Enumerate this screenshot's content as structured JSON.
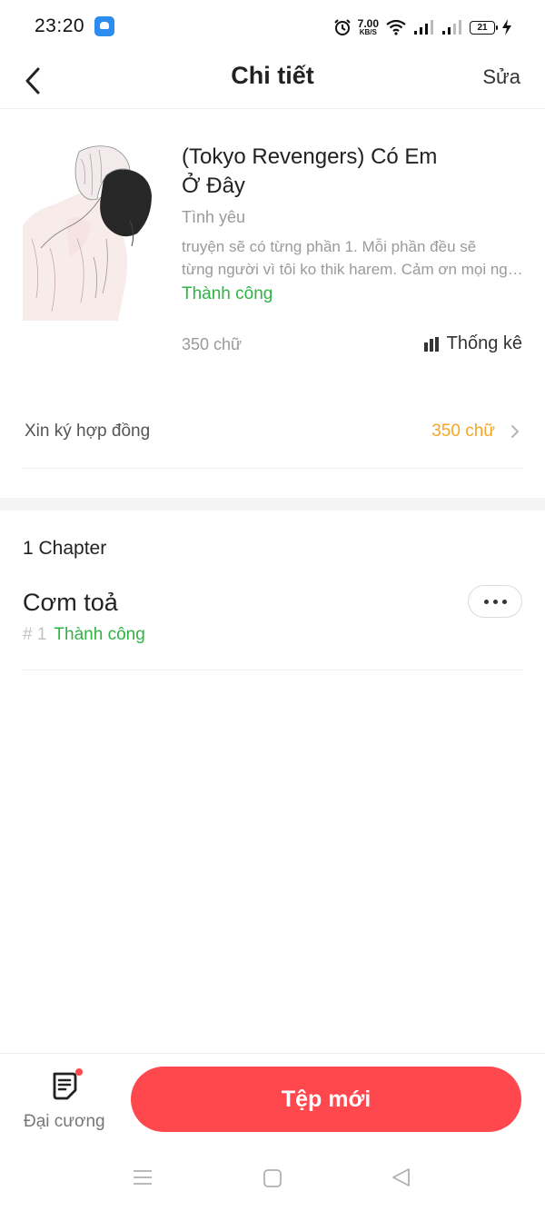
{
  "status_bar": {
    "time": "23:20",
    "speed_value": "7.00",
    "speed_unit": "KB/S",
    "battery": "21",
    "icons": [
      "app-store-icon",
      "alarm-icon",
      "wifi-icon",
      "signal-icon",
      "signal-icon",
      "battery-icon",
      "charging-icon"
    ]
  },
  "header": {
    "title": "Chi tiết",
    "edit_label": "Sửa",
    "back_icon": "chevron-left-icon"
  },
  "book": {
    "title": "(Tokyo Revengers) Có Em Ở Đây",
    "genre": "Tình yêu",
    "description_line1": "truyện sẽ có từng phần 1. Mỗi phần đều sẽ",
    "description_line2": "từng người vì tôi ko thik harem. Cảm ơn mọi người",
    "status": "Thành công",
    "word_count": "350 chữ",
    "stats_label": "Thống kê",
    "stats_icon": "bar-chart-icon"
  },
  "contract": {
    "label": "Xin ký hợp đồng",
    "value": "350 chữ"
  },
  "chapters": {
    "count_label": "1 Chapter",
    "items": [
      {
        "title": "Cơm toả",
        "number": "# 1",
        "status": "Thành công"
      }
    ]
  },
  "bottom_bar": {
    "outline_label": "Đại cương",
    "new_file_label": "Tệp mới"
  },
  "colors": {
    "success": "#2fb344",
    "accent": "#ff484d",
    "warning": "#f5a623"
  }
}
